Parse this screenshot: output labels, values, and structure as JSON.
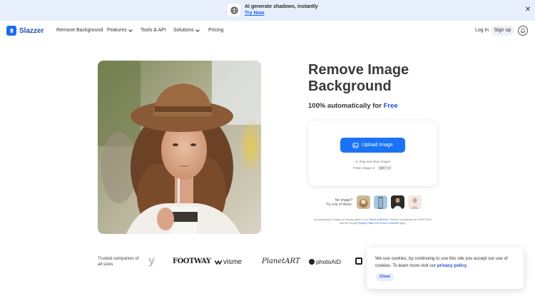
{
  "promo": {
    "title": "AI generate shadows, instantly",
    "link": "Try Now",
    "icon": "globe-icon"
  },
  "nav": {
    "logo": "Slazzer",
    "items": [
      {
        "label": "Remove Background",
        "dropdown": false
      },
      {
        "label": "Features",
        "dropdown": true
      },
      {
        "label": "Tools & API",
        "dropdown": false
      },
      {
        "label": "Solutions",
        "dropdown": true
      },
      {
        "label": "Pricing",
        "dropdown": false
      }
    ],
    "login": "Log in",
    "signup": "Sign up"
  },
  "hero": {
    "title": "Remove Image Background",
    "subtitle_prefix": "100% automatically for",
    "subtitle_free": "Free"
  },
  "upload": {
    "button_label": "Upload Image",
    "drop_text": "or drag and drop images",
    "paste_text": "Paste image or",
    "paste_shortcut": "Ctrl + V"
  },
  "samples": {
    "prompt_line1": "No image?",
    "prompt_line2": "Try one of these:"
  },
  "legal": {
    "p1": "By uploading an image you hereby agree to our",
    "terms": "Terms of Service",
    "p2": ". This site is protected by reCAPTCHA and the Google",
    "privacy": "Privacy Policy",
    "p3": "and",
    "terms2": "Terms of Service",
    "p4": "apply."
  },
  "trusted": {
    "label": "Trusted companies of all sizes",
    "brands": [
      "y",
      "FOOTWAY",
      "visme",
      "PlanetART",
      "photoAiD"
    ]
  },
  "cookie": {
    "text": "We use cookies, by continuing to use this site you accept our use of cookies.  To learn more visit our",
    "link": "privacy policy",
    "period": ".",
    "close": "Close"
  },
  "colors": {
    "accent": "#1a73f5",
    "brand": "#1f6bf0",
    "banner_bg": "#e7eefc"
  }
}
